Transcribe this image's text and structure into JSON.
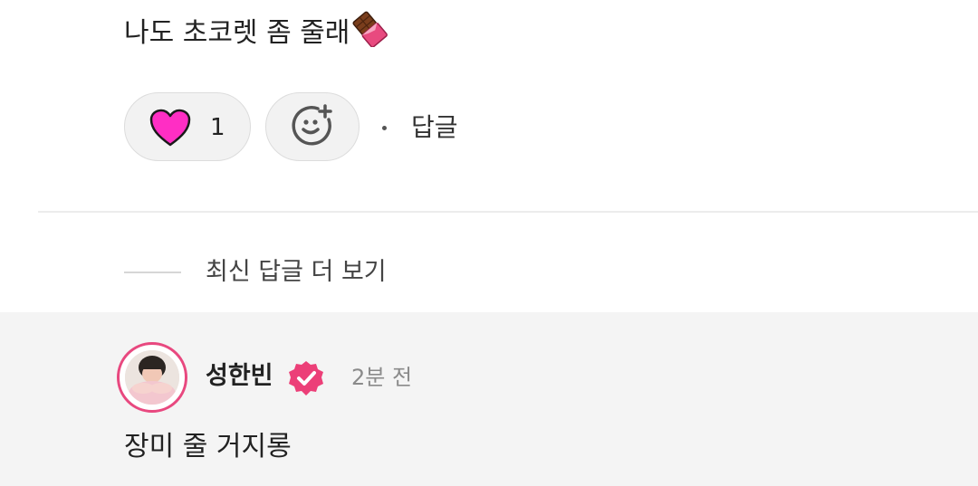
{
  "comment": {
    "text": "나도 초코렛 좀 줄래",
    "emoji_icon": "chocolate-bar-icon",
    "like_count": "1",
    "reply_label": "답글"
  },
  "thread": {
    "more_replies_label": "최신 답글 더 보기"
  },
  "reply": {
    "author": "성한빈",
    "time": "2분 전",
    "text": "장미 줄 거지롱"
  },
  "colors": {
    "heart": "#ff2ec4",
    "accent_pink": "#e8487f"
  }
}
